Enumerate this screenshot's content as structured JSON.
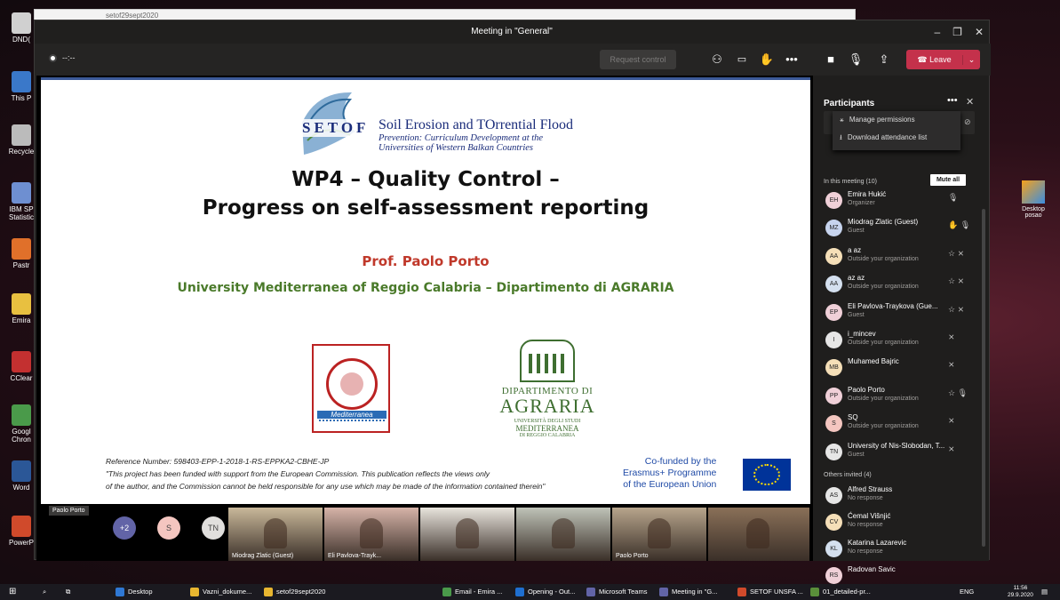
{
  "desktop": {
    "icons": [
      {
        "label": "DND(",
        "color": "#d0d0d0"
      },
      {
        "label": "This P",
        "color": "#3a78c9"
      },
      {
        "label": "Recycle",
        "color": "#bbbbbb"
      },
      {
        "label": "IBM SP Statistic",
        "color": "#6e8fd1"
      },
      {
        "label": "Pastr",
        "color": "#e0702a"
      },
      {
        "label": "Emira",
        "color": "#e8c040"
      },
      {
        "label": "CClear",
        "color": "#c33030"
      },
      {
        "label": "Googl Chron",
        "color": "#4a9a4a"
      },
      {
        "label": "Word",
        "color": "#2b5797"
      },
      {
        "label": "PowerP",
        "color": "#d04a2b"
      }
    ],
    "right_icon_label": "Desktop posao",
    "bg_window_title": "setof29sept2020"
  },
  "window": {
    "title": "Meeting in \"General\""
  },
  "toolbar": {
    "timer": "--:--",
    "request_control": "Request control",
    "leave": "Leave"
  },
  "slide": {
    "setof": "SETOF",
    "setof_full": "Soil Erosion and TOrrential Flood",
    "subtitle_1": "Prevention: Curriculum Development at the",
    "subtitle_2": "Universities of Western Balkan Countries",
    "title_1": "WP4 – Quality Control –",
    "title_2": "Progress on self-assessment reporting",
    "author": "Prof. Paolo Porto",
    "university": "University Mediterranea of Reggio Calabria – Dipartimento di AGRARIA",
    "seal_text": "Mediterranea",
    "dept_1": "DIPARTIMENTO DI",
    "dept_2": "AGRARIA",
    "dept_3": "UNIVERSITÀ DEGLI STUDI",
    "dept_4": "MEDITERRANEA",
    "dept_5": "DI REGGIO CALABRIA",
    "ref_number": "Reference Number: 598403-EPP-1-2018-1-RS-EPPKA2-CBHE-JP",
    "disclaimer_1": "\"This project has been funded with support from the European Commission. This publication reflects the views only",
    "disclaimer_2": "of the author, and the Commission cannot be held responsible for any use which may be made of the information contained therein\"",
    "erasmus_1": "Co-funded by the",
    "erasmus_2": "Erasmus+ Programme",
    "erasmus_3": "of the European Union"
  },
  "presenter_label": "Paolo Porto",
  "filmstrip": {
    "avatars": [
      {
        "text": "+2",
        "bg": "#6264a7",
        "fg": "#fff"
      },
      {
        "text": "S",
        "bg": "#f4c6c0",
        "fg": "#444"
      },
      {
        "text": "TN",
        "bg": "#e1dfdd",
        "fg": "#444"
      }
    ],
    "videos": [
      {
        "name": "Miodrag Zlatic (Guest)",
        "bg": "#c9b89a"
      },
      {
        "name": "Eli Pavlova-Trayk...",
        "bg": "#d6b3a8"
      },
      {
        "name": "",
        "bg": "#e8e4dc"
      },
      {
        "name": "",
        "bg": "#bfc3b8"
      },
      {
        "name": "Paolo Porto",
        "bg": "#b7a58c"
      },
      {
        "name": "",
        "bg": "#8a7058"
      }
    ]
  },
  "panel": {
    "title": "Participants",
    "menu": [
      "Manage permissions",
      "Download attendance list"
    ],
    "in_meeting": "In this meeting (10)",
    "mute_all": "Mute all",
    "people": [
      {
        "init": "EH",
        "name": "Emira Hukić",
        "sub": "Organizer",
        "bg": "#f0d0d8",
        "icons": "🎙"
      },
      {
        "init": "MZ",
        "name": "Miodrag Zlatic (Guest)",
        "sub": "Guest",
        "bg": "#c7d4ee",
        "icons": "✋ 🎙"
      },
      {
        "init": "AA",
        "name": "a az",
        "sub": "Outside your organization",
        "bg": "#f5dfb8",
        "icons": "☆ ⨯"
      },
      {
        "init": "AA",
        "name": "az az",
        "sub": "Outside your organization",
        "bg": "#d4e0ef",
        "icons": "☆ ⨯"
      },
      {
        "init": "EP",
        "name": "Eli Pavlova-Traykova (Gue...",
        "sub": "Guest",
        "bg": "#f0d0d8",
        "icons": "☆ ⨯"
      },
      {
        "init": "I",
        "name": "i_mincev",
        "sub": "Outside your organization",
        "bg": "#e6e6e6",
        "icons": "⨯"
      },
      {
        "init": "MB",
        "name": "Muhamed Bajric",
        "sub": "",
        "bg": "#f5dfb8",
        "icons": "⨯"
      },
      {
        "init": "PP",
        "name": "Paolo Porto",
        "sub": "Outside your organization",
        "bg": "#f0d0d8",
        "icons": "☆ 🎙"
      },
      {
        "init": "S",
        "name": "SQ",
        "sub": "Outside your organization",
        "bg": "#f4c6c0",
        "icons": "⨯"
      },
      {
        "init": "TN",
        "name": "University of Nis-Slobodan, T...",
        "sub": "Guest",
        "bg": "#e6e6e6",
        "icons": "⨯"
      }
    ],
    "others": "Others invited (4)",
    "invited": [
      {
        "init": "AS",
        "name": "Alfred Strauss",
        "sub": "No response",
        "bg": "#e6e6e6"
      },
      {
        "init": "CV",
        "name": "Ćemal Višnjić",
        "sub": "No response",
        "bg": "#f5dfb8"
      },
      {
        "init": "KL",
        "name": "Katarina Lazarevic",
        "sub": "No response",
        "bg": "#d4e0ef"
      },
      {
        "init": "RS",
        "name": "Radovan Savic",
        "sub": "",
        "bg": "#f0d0d8"
      }
    ]
  },
  "taskbar": {
    "items": [
      {
        "label": "Desktop",
        "color": "#2f78d4"
      },
      {
        "label": "Vazni_dokume...",
        "color": "#e8b630"
      },
      {
        "label": "setof29sept2020",
        "color": "#e8b630"
      },
      {
        "label": "Email - Emira ...",
        "color": "#4a9a4a"
      },
      {
        "label": "Opening - Out...",
        "color": "#1f6fd0"
      },
      {
        "label": "Microsoft Teams",
        "color": "#6264a7"
      },
      {
        "label": "Meeting in \"G...",
        "color": "#6264a7"
      },
      {
        "label": "SETOF UNSFA ...",
        "color": "#d04a2b"
      },
      {
        "label": "01_detailed-pr...",
        "color": "#5a8f3a"
      }
    ],
    "lang": "ENG",
    "time": "11:56",
    "date": "29.9.2020"
  }
}
